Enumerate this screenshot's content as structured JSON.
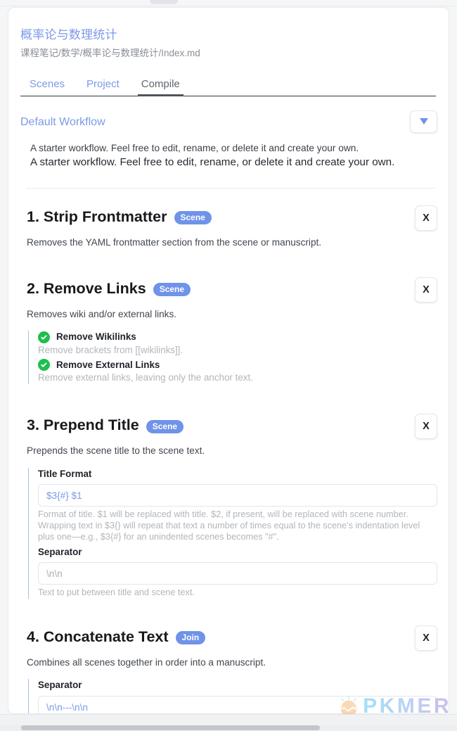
{
  "document": {
    "title": "概率论与数理统计",
    "path": "课程笔记/数学/概率论与数理统计/Index.md"
  },
  "tabs": [
    {
      "label": "Scenes",
      "active": false
    },
    {
      "label": "Project",
      "active": false
    },
    {
      "label": "Compile",
      "active": true
    }
  ],
  "workflow": {
    "name": "Default Workflow",
    "toggle_icon": "chevron-down-icon",
    "description_small": "A starter workflow. Feel free to edit, rename, or delete it and create your own.",
    "description_large": "A starter workflow. Feel free to edit, rename, or delete it and create your own."
  },
  "steps": [
    {
      "title": "1. Strip Frontmatter",
      "badge": "Scene",
      "description": "Removes the YAML frontmatter section from the scene or manuscript.",
      "delete_label": "X",
      "options": [],
      "fields": []
    },
    {
      "title": "2. Remove Links",
      "badge": "Scene",
      "description": "Removes wiki and/or external links.",
      "delete_label": "X",
      "options": [
        {
          "label": "Remove Wikilinks",
          "help": "Remove brackets from [[wikilinks]].",
          "checked": true
        },
        {
          "label": "Remove External Links",
          "help": "Remove external links, leaving only the anchor text.",
          "checked": true
        }
      ],
      "fields": []
    },
    {
      "title": "3. Prepend Title",
      "badge": "Scene",
      "description": "Prepends the scene title to the scene text.",
      "delete_label": "X",
      "options": [],
      "fields": [
        {
          "label": "Title Format",
          "value": "$3{#} $1",
          "muted": false,
          "help": "Format of title. $1 will be replaced with title. $2, if present, will be replaced with scene number. Wrapping text in $3{} will repeat that text a number of times equal to the scene's indentation level plus one—e.g., $3{#} for an unindented scenes becomes \"#\"."
        },
        {
          "label": "Separator",
          "value": "\\n\\n",
          "muted": true,
          "help": "Text to put between title and scene text."
        }
      ]
    },
    {
      "title": "4. Concatenate Text",
      "badge": "Join",
      "description": "Combines all scenes together in order into a manuscript.",
      "delete_label": "X",
      "options": [],
      "fields": [
        {
          "label": "Separator",
          "value": "\\n\\n---\\n\\n",
          "muted": false,
          "help": ""
        }
      ]
    }
  ],
  "watermark": {
    "text": "PKMER",
    "icon": "pkmer-egg-logo"
  },
  "colors": {
    "accent_blue": "#7b9ae8",
    "badge_blue": "#6f93e8",
    "check_green": "#1fbe4d",
    "muted_text": "#b2b6bb"
  }
}
